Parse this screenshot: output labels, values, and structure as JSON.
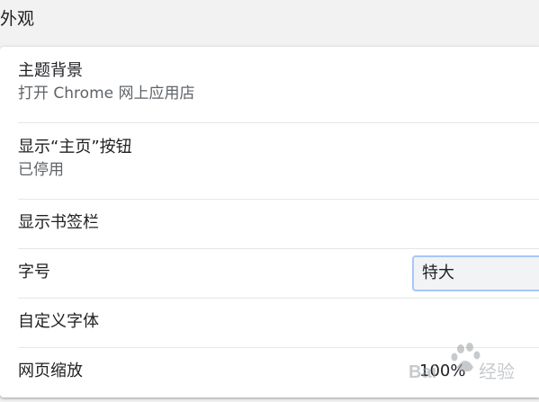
{
  "section": {
    "title": "外观"
  },
  "settings": {
    "theme": {
      "label": "主题背景",
      "sublabel": "打开 Chrome 网上应用店"
    },
    "home_button": {
      "label": "显示“主页”按钮",
      "sublabel": "已停用"
    },
    "bookmarks_bar": {
      "label": "显示书签栏"
    },
    "font_size": {
      "label": "字号",
      "selected": "特大"
    },
    "custom_fonts": {
      "label": "自定义字体"
    },
    "page_zoom": {
      "label": "网页缩放",
      "selected": "100%"
    }
  },
  "watermark": {
    "text": "Baidu 经验"
  },
  "colors": {
    "select_border": "#a8c7fa",
    "select_bg": "#f1f3f4",
    "page_bg": "#f2f2f2",
    "card_bg": "#ffffff"
  }
}
